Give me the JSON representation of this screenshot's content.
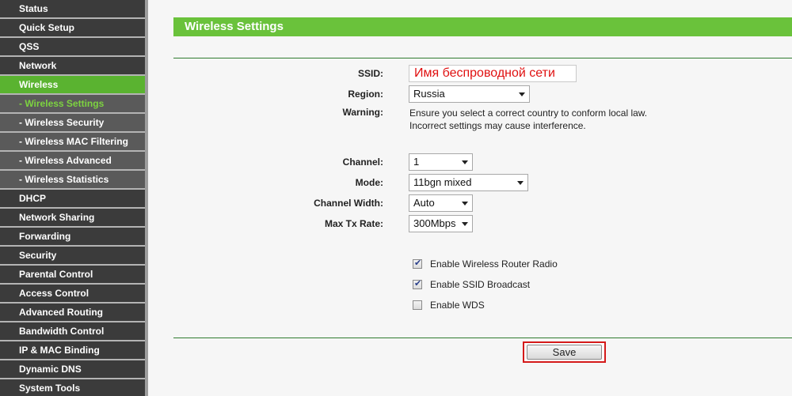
{
  "sidebar": {
    "items": [
      {
        "label": "Status",
        "type": "main",
        "state": "normal"
      },
      {
        "label": "Quick Setup",
        "type": "main",
        "state": "normal"
      },
      {
        "label": "QSS",
        "type": "main",
        "state": "normal"
      },
      {
        "label": "Network",
        "type": "main",
        "state": "normal"
      },
      {
        "label": "Wireless",
        "type": "main",
        "state": "active"
      },
      {
        "label": "- Wireless Settings",
        "type": "sub",
        "state": "current"
      },
      {
        "label": "- Wireless Security",
        "type": "sub",
        "state": "normal"
      },
      {
        "label": "- Wireless MAC Filtering",
        "type": "sub",
        "state": "normal"
      },
      {
        "label": "- Wireless Advanced",
        "type": "sub",
        "state": "normal"
      },
      {
        "label": "- Wireless Statistics",
        "type": "sub",
        "state": "normal"
      },
      {
        "label": "DHCP",
        "type": "main",
        "state": "normal"
      },
      {
        "label": "Network Sharing",
        "type": "main",
        "state": "normal"
      },
      {
        "label": "Forwarding",
        "type": "main",
        "state": "normal"
      },
      {
        "label": "Security",
        "type": "main",
        "state": "normal"
      },
      {
        "label": "Parental Control",
        "type": "main",
        "state": "normal"
      },
      {
        "label": "Access Control",
        "type": "main",
        "state": "normal"
      },
      {
        "label": "Advanced Routing",
        "type": "main",
        "state": "normal"
      },
      {
        "label": "Bandwidth Control",
        "type": "main",
        "state": "normal"
      },
      {
        "label": "IP & MAC Binding",
        "type": "main",
        "state": "normal"
      },
      {
        "label": "Dynamic DNS",
        "type": "main",
        "state": "normal"
      },
      {
        "label": "System Tools",
        "type": "main",
        "state": "normal"
      }
    ]
  },
  "page": {
    "title": "Wireless Settings"
  },
  "form": {
    "ssid_label": "SSID:",
    "ssid_value": "Имя беспроводной сети",
    "region_label": "Region:",
    "region_value": "Russia",
    "warning_label": "Warning:",
    "warning_line1": "Ensure you select a correct country to conform local law.",
    "warning_line2": "Incorrect settings may cause interference.",
    "channel_label": "Channel:",
    "channel_value": "1",
    "mode_label": "Mode:",
    "mode_value": "11bgn mixed",
    "width_label": "Channel Width:",
    "width_value": "Auto",
    "rate_label": "Max Tx Rate:",
    "rate_value": "300Mbps",
    "checks": [
      {
        "label": "Enable Wireless Router Radio",
        "checked": true
      },
      {
        "label": "Enable SSID Broadcast",
        "checked": true
      },
      {
        "label": "Enable WDS",
        "checked": false
      }
    ],
    "save_label": "Save"
  },
  "colors": {
    "accent_green": "#6ac23b",
    "sidebar_bg": "#3b3b3b",
    "highlight_red": "#d41a1a",
    "ssid_text": "#e01010"
  }
}
